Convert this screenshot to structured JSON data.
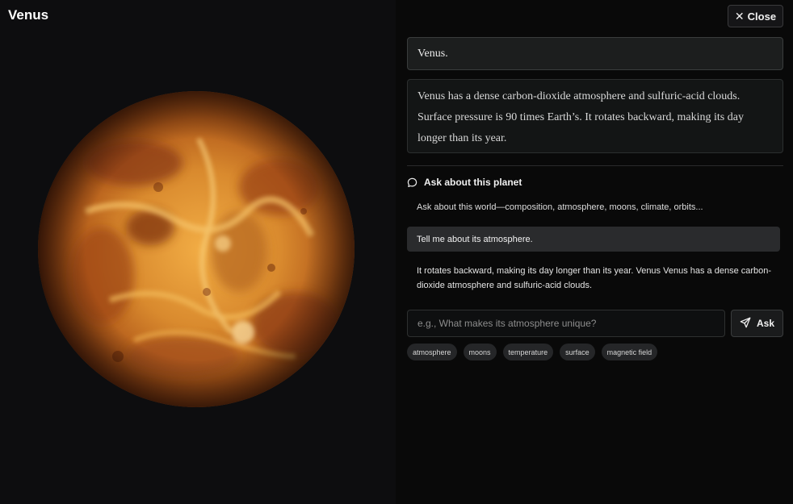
{
  "header": {
    "title": "Venus",
    "close_label": "Close"
  },
  "planet": {
    "name": "Venus",
    "image_alt": "Venus"
  },
  "info": {
    "short_answer": "Venus.",
    "description": "Venus has a dense carbon-dioxide atmosphere and sulfuric-acid clouds. Surface pressure is 90 times Earth’s. It rotates backward, making its day longer than its year."
  },
  "chat": {
    "heading": "Ask about this planet",
    "hint": "Ask about this world—composition, atmosphere, moons, climate, orbits...",
    "messages": [
      {
        "role": "user",
        "text": "Tell me about its atmosphere."
      },
      {
        "role": "assistant",
        "text": "It rotates backward, making its day longer than its year. Venus Venus has a dense carbon-dioxide atmosphere and sulfuric-acid clouds."
      }
    ],
    "input_placeholder": "e.g., What makes its atmosphere unique?",
    "input_value": "",
    "ask_label": "Ask",
    "chips": [
      "atmosphere",
      "moons",
      "temperature",
      "surface",
      "magnetic field"
    ]
  },
  "icons": {
    "close": "close-icon",
    "chat": "chat-bubble-icon",
    "send": "send-icon"
  },
  "colors": {
    "planet_core": "#f0a83c",
    "planet_mid": "#c2621c",
    "planet_edge": "#5a2208",
    "background": "#0b0b0d"
  }
}
